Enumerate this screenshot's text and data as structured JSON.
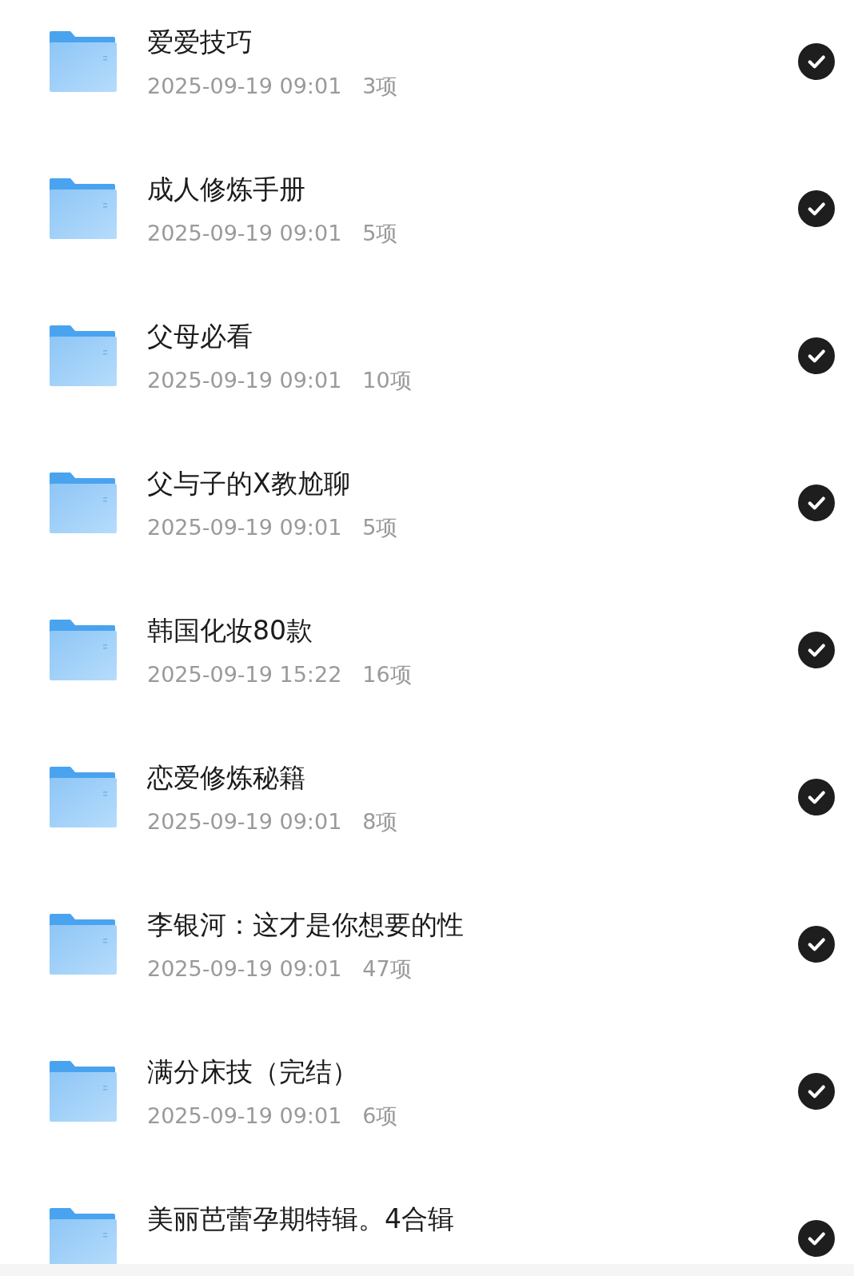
{
  "folders": [
    {
      "name": "爱爱技巧",
      "modified": "2025-09-19 09:01",
      "count": "3项",
      "selected": true
    },
    {
      "name": "成人修炼手册",
      "modified": "2025-09-19 09:01",
      "count": "5项",
      "selected": true
    },
    {
      "name": "父母必看",
      "modified": "2025-09-19 09:01",
      "count": "10项",
      "selected": true
    },
    {
      "name": "父与子的X教尬聊",
      "modified": "2025-09-19 09:01",
      "count": "5项",
      "selected": true
    },
    {
      "name": "韩国化妆80款",
      "modified": "2025-09-19 15:22",
      "count": "16项",
      "selected": true
    },
    {
      "name": "恋爱修炼秘籍",
      "modified": "2025-09-19 09:01",
      "count": "8项",
      "selected": true
    },
    {
      "name": "李银河：这才是你想要的性",
      "modified": "2025-09-19 09:01",
      "count": "47项",
      "selected": true
    },
    {
      "name": "满分床技（完结）",
      "modified": "2025-09-19 09:01",
      "count": "6项",
      "selected": true
    },
    {
      "name": "美丽芭蕾孕期特辑。4合辑",
      "selected": true
    }
  ]
}
